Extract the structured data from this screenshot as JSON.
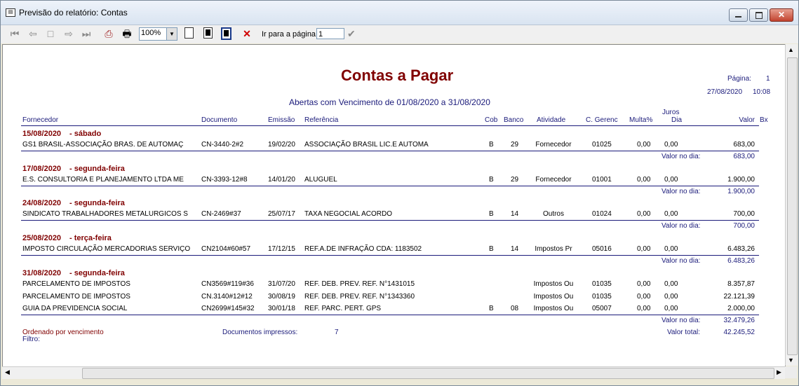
{
  "window": {
    "title": "Previsão do relatório: Contas",
    "icon": "report-preview-icon"
  },
  "toolbar": {
    "zoom": "100%",
    "goto_label": "Ir para a página",
    "goto_value": "1"
  },
  "report": {
    "title": "Contas a Pagar",
    "subtitle": "Abertas com Vencimento de 01/08/2020 a 31/08/2020",
    "page_label": "Página:",
    "page_number": "1",
    "print_date": "27/08/2020",
    "print_time": "10:08",
    "columns": {
      "fornecedor": "Fornecedor",
      "documento": "Documento",
      "emissao": "Emissão",
      "referencia": "Referência",
      "cob": "Cob",
      "banco": "Banco",
      "atividade": "Atividade",
      "cgerenc": "C. Gerenc",
      "multa": "Multa%",
      "juros_top": "Juros",
      "juros_bottom": "Dia",
      "valor": "Valor",
      "bx": "Bx"
    },
    "day_total_label": "Valor no dia:",
    "groups": [
      {
        "date": "15/08/2020",
        "weekday": "- sábado",
        "total": "683,00",
        "rows": [
          {
            "fornecedor": "GS1 BRASIL-ASSOCIAÇÃO BRAS. DE AUTOMAÇ",
            "documento": "CN-3440-2#2",
            "emissao": "19/02/20",
            "referencia": "ASSOCIAÇÃO BRASIL LIC.E AUTOMA",
            "cob": "B",
            "banco": "29",
            "atividade": "Fornecedor",
            "cgerenc": "01025",
            "multa": "0,00",
            "juros": "0,00",
            "valor": "683,00"
          }
        ]
      },
      {
        "date": "17/08/2020",
        "weekday": "- segunda-feira",
        "total": "1.900,00",
        "rows": [
          {
            "fornecedor": "E.S. CONSULTORIA E PLANEJAMENTO LTDA ME",
            "documento": "CN-3393-12#8",
            "emissao": "14/01/20",
            "referencia": "ALUGUEL",
            "cob": "B",
            "banco": "29",
            "atividade": "Fornecedor",
            "cgerenc": "01001",
            "multa": "0,00",
            "juros": "0,00",
            "valor": "1.900,00"
          }
        ]
      },
      {
        "date": "24/08/2020",
        "weekday": "- segunda-feira",
        "total": "700,00",
        "rows": [
          {
            "fornecedor": "SINDICATO TRABALHADORES METALURGICOS S",
            "documento": "CN-2469#37",
            "emissao": "25/07/17",
            "referencia": "TAXA NEGOCIAL ACORDO",
            "cob": "B",
            "banco": "14",
            "atividade": "Outros",
            "cgerenc": "01024",
            "multa": "0,00",
            "juros": "0,00",
            "valor": "700,00"
          }
        ]
      },
      {
        "date": "25/08/2020",
        "weekday": "- terça-feira",
        "total": "6.483,26",
        "rows": [
          {
            "fornecedor": "IMPOSTO CIRCULAÇÃO MERCADORIAS SERVIÇO",
            "documento": "CN2104#60#57",
            "emissao": "17/12/15",
            "referencia": "REF.A.DE INFRAÇÃO CDA: 1183502",
            "cob": "B",
            "banco": "14",
            "atividade": "Impostos Pr",
            "cgerenc": "05016",
            "multa": "0,00",
            "juros": "0,00",
            "valor": "6.483,26"
          }
        ]
      },
      {
        "date": "31/08/2020",
        "weekday": "- segunda-feira",
        "total": "32.479,26",
        "rows": [
          {
            "fornecedor": "PARCELAMENTO DE IMPOSTOS",
            "documento": "CN3569#119#36",
            "emissao": "31/07/20",
            "referencia": "REF. DEB. PREV. REF. N°1431015",
            "cob": "",
            "banco": "",
            "atividade": "Impostos Ou",
            "cgerenc": "01035",
            "multa": "0,00",
            "juros": "0,00",
            "valor": "8.357,87"
          },
          {
            "fornecedor": "PARCELAMENTO DE IMPOSTOS",
            "documento": "CN.3140#12#12",
            "emissao": "30/08/19",
            "referencia": "REF. DEB. PREV. REF. N°1343360",
            "cob": "",
            "banco": "",
            "atividade": "Impostos Ou",
            "cgerenc": "01035",
            "multa": "0,00",
            "juros": "0,00",
            "valor": "22.121,39"
          },
          {
            "fornecedor": "GUIA DA PREVIDENCIA SOCIAL",
            "documento": "CN2699#145#32",
            "emissao": "30/01/18",
            "referencia": "REF. PARC. PERT. GPS",
            "cob": "B",
            "banco": "08",
            "atividade": "Impostos Ou",
            "cgerenc": "05007",
            "multa": "0,00",
            "juros": "0,00",
            "valor": "2.000,00"
          }
        ]
      }
    ],
    "footer": {
      "order_label": "Ordenado por vencimento",
      "filter_label": "Filtro:",
      "docs_label": "Documentos impressos:",
      "docs_count": "7",
      "total_label": "Valor total:",
      "total_value": "42.245,52"
    }
  }
}
